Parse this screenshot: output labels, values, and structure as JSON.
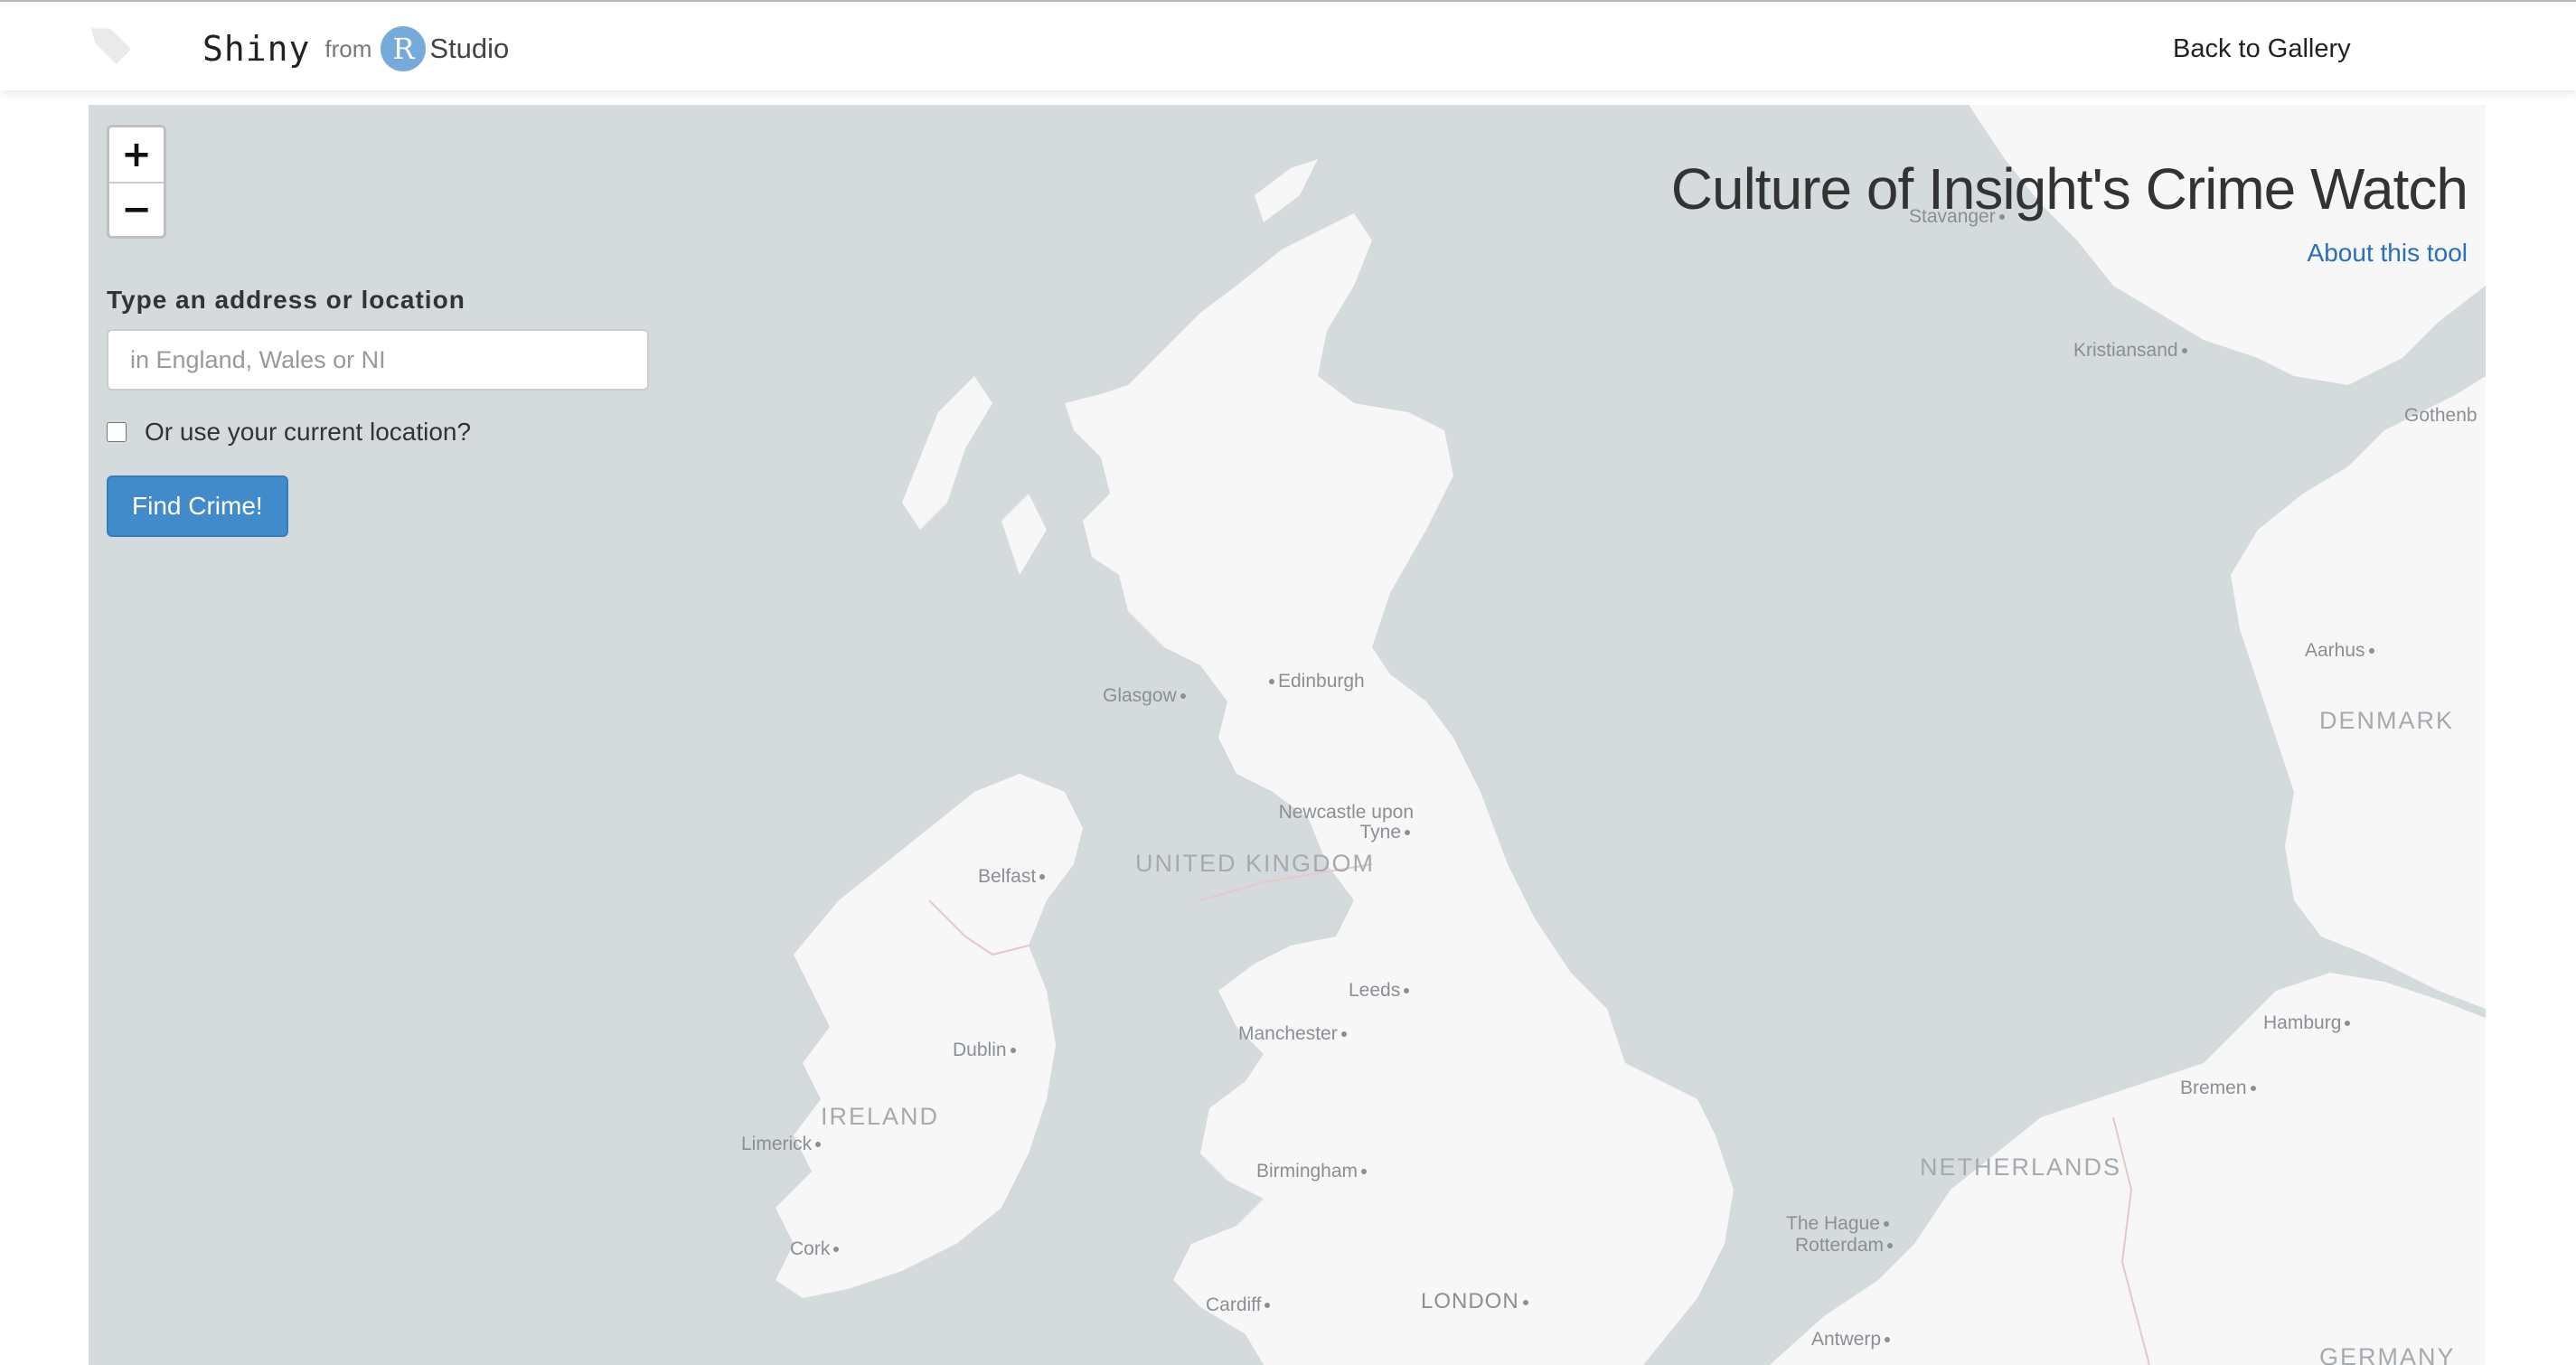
{
  "header": {
    "brand_shiny": "Shiny",
    "brand_from": "from",
    "brand_r": "R",
    "brand_studio": "Studio",
    "back_link": "Back to Gallery"
  },
  "map": {
    "zoom_in": "+",
    "zoom_out": "−",
    "labels": {
      "stavanger": "Stavanger",
      "kristiansand": "Kristiansand",
      "gothenburg": "Gothenb",
      "aarhus": "Aarhus",
      "denmark": "DENMARK",
      "edinburgh": "Edinburgh",
      "glasgow": "Glasgow",
      "newcastle": "Newcastle upon Tyne",
      "uk": "UNITED KINGDOM",
      "belfast": "Belfast",
      "leeds": "Leeds",
      "manchester": "Manchester",
      "dublin": "Dublin",
      "ireland": "IRELAND",
      "limerick": "Limerick",
      "birmingham": "Birmingham",
      "cork": "Cork",
      "cardiff": "Cardiff",
      "london": "LONDON",
      "hamburg": "Hamburg",
      "bremen": "Bremen",
      "netherlands": "NETHERLANDS",
      "thehague": "The Hague",
      "rotterdam": "Rotterdam",
      "antwerp": "Antwerp",
      "germany": "GERMANY"
    }
  },
  "controls": {
    "address_label": "Type an address or location",
    "address_placeholder": "in England, Wales or NI",
    "location_checkbox_label": "Or use your current location?",
    "find_button": "Find Crime!"
  },
  "panel": {
    "title": "Culture of Insight's Crime Watch",
    "about_link": "About this tool"
  },
  "colors": {
    "water": "#d5dadc",
    "land": "#f7f7f7",
    "accent": "#428bca",
    "r_logo": "#75aadb"
  }
}
